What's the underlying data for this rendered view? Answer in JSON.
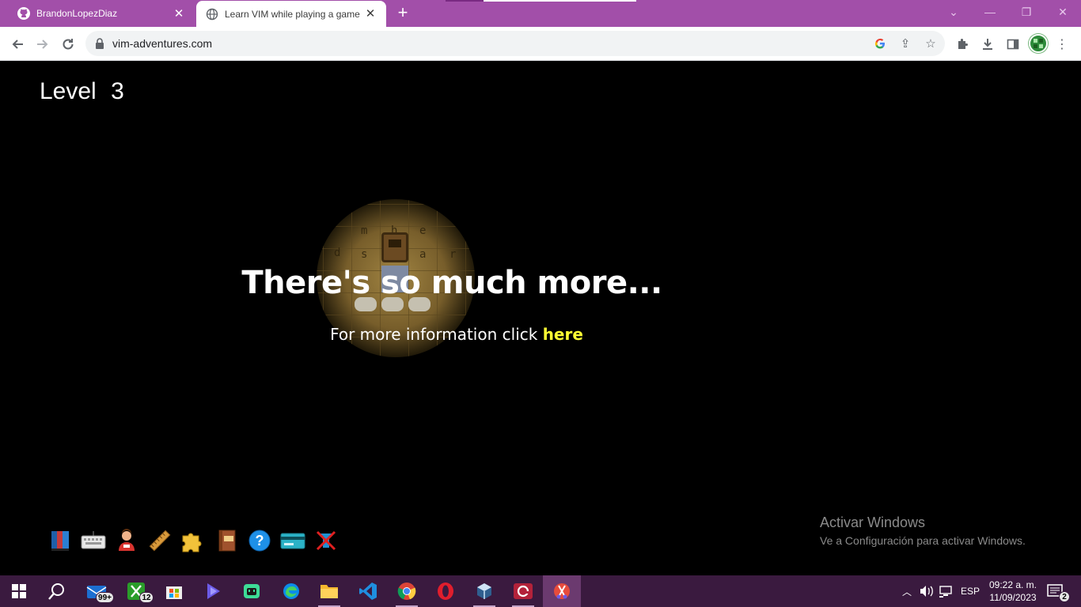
{
  "browser": {
    "tabs": [
      {
        "title": "BrandonLopezDiaz",
        "icon": "github-icon",
        "active": false
      },
      {
        "title": "Learn VIM while playing a game",
        "icon": "globe-icon",
        "active": true
      }
    ],
    "new_tab_label": "+",
    "url": "vim-adventures.com",
    "theme_color": "#a24fa9"
  },
  "game": {
    "level_label": "Level",
    "level_number": "3",
    "headline": "There's so much more...",
    "info_text": "For more information click ",
    "info_link": "here",
    "link_color": "#ffff33",
    "toolbar_icons": [
      "book-icon",
      "keyboard-icon",
      "character-icon",
      "ruler-icon",
      "puzzle-icon",
      "vim-manual-icon",
      "help-icon",
      "credit-card-icon",
      "mute-icon"
    ]
  },
  "watermark": {
    "title": "Activar Windows",
    "subtitle": "Ve a Configuración para activar Windows."
  },
  "taskbar": {
    "mail_badge": "99+",
    "xbox_badge": "12",
    "language": "ESP",
    "time": "09:22 a. m.",
    "date": "11/09/2023",
    "notification_count": "2"
  }
}
